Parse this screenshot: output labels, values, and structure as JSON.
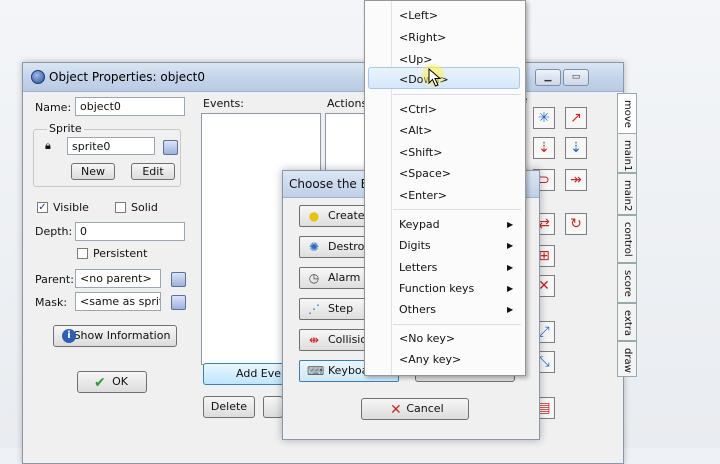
{
  "window": {
    "title": "Object Properties: object0"
  },
  "left_panel": {
    "name_label": "Name:",
    "name_value": "object0",
    "sprite_group_label": "Sprite",
    "sprite_value": "sprite0",
    "new_button": "New",
    "edit_button": "Edit",
    "visible_label": "Visible",
    "visible_checked": true,
    "solid_label": "Solid",
    "solid_checked": false,
    "depth_label": "Depth:",
    "depth_value": "0",
    "persistent_label": "Persistent",
    "persistent_checked": false,
    "parent_label": "Parent:",
    "parent_value": "<no parent>",
    "mask_label": "Mask:",
    "mask_value": "<same as sprite>",
    "show_info_button": "Show Information",
    "ok_button": "OK"
  },
  "events_panel": {
    "events_label": "Events:",
    "actions_label": "Actions:",
    "add_event_button": "Add Eve",
    "delete_button": "Delete"
  },
  "action_tabs": [
    "move",
    "main1",
    "main2",
    "control",
    "score",
    "extra",
    "draw"
  ],
  "action_tab_partial_label": "ve",
  "choose_event_dialog": {
    "title": "Choose the Ev",
    "buttons": [
      {
        "label": "Create",
        "icon": "lightbulb-icon"
      },
      {
        "label": "Destroy",
        "icon": "destroy-icon"
      },
      {
        "label": "Alarm",
        "icon": "clock-icon"
      },
      {
        "label": "Step",
        "icon": "steps-icon"
      },
      {
        "label": "Collision",
        "icon": "collision-icon"
      },
      {
        "label": "Keyboard",
        "icon": "keyboard-icon"
      }
    ],
    "cancel_button": "Cancel"
  },
  "key_menu": {
    "items": [
      {
        "label": "<Left>"
      },
      {
        "label": "<Right>"
      },
      {
        "label": "<Up>"
      },
      {
        "label": "<Down>",
        "highlighted": true
      },
      {
        "label": "<Ctrl>"
      },
      {
        "label": "<Alt>"
      },
      {
        "label": "<Shift>"
      },
      {
        "label": "<Space>"
      },
      {
        "label": "<Enter>"
      },
      {
        "label": "Keypad",
        "submenu": true
      },
      {
        "label": "Digits",
        "submenu": true
      },
      {
        "label": "Letters",
        "submenu": true
      },
      {
        "label": "Function keys",
        "submenu": true
      },
      {
        "label": "Others",
        "submenu": true
      },
      {
        "label": "<No key>"
      },
      {
        "label": "<Any key>"
      }
    ]
  },
  "colors": {
    "accent": "#1f4fa0",
    "highlight": "#d6e7fa",
    "cancel_red": "#c62828",
    "ok_green": "#2e9d3a"
  }
}
